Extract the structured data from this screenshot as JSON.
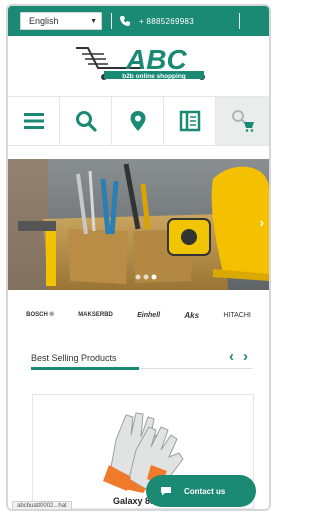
{
  "topbar": {
    "language": "English",
    "phone": "+ 8885269983"
  },
  "logo": {
    "brand": "ABC",
    "tagline": "b2b online shopping"
  },
  "iconrow": {
    "icons": [
      "menu-icon",
      "search-icon",
      "location-pin-icon",
      "book-icon",
      "cart-icon"
    ]
  },
  "brands": [
    "BOSCH ®",
    "MAKSERBD",
    "Einhell",
    "Aks",
    "HITACHI"
  ],
  "best_selling": {
    "title": "Best Selling Products",
    "prev": "‹",
    "next": "›"
  },
  "product": {
    "name": "Galaxy 88"
  },
  "contact": {
    "label": "Contact us"
  },
  "status_url": "abcbuatt0002...hat",
  "colors": {
    "primary": "#1b8a74",
    "hero_bg": "#6f7578",
    "helmet": "#f4c000"
  }
}
